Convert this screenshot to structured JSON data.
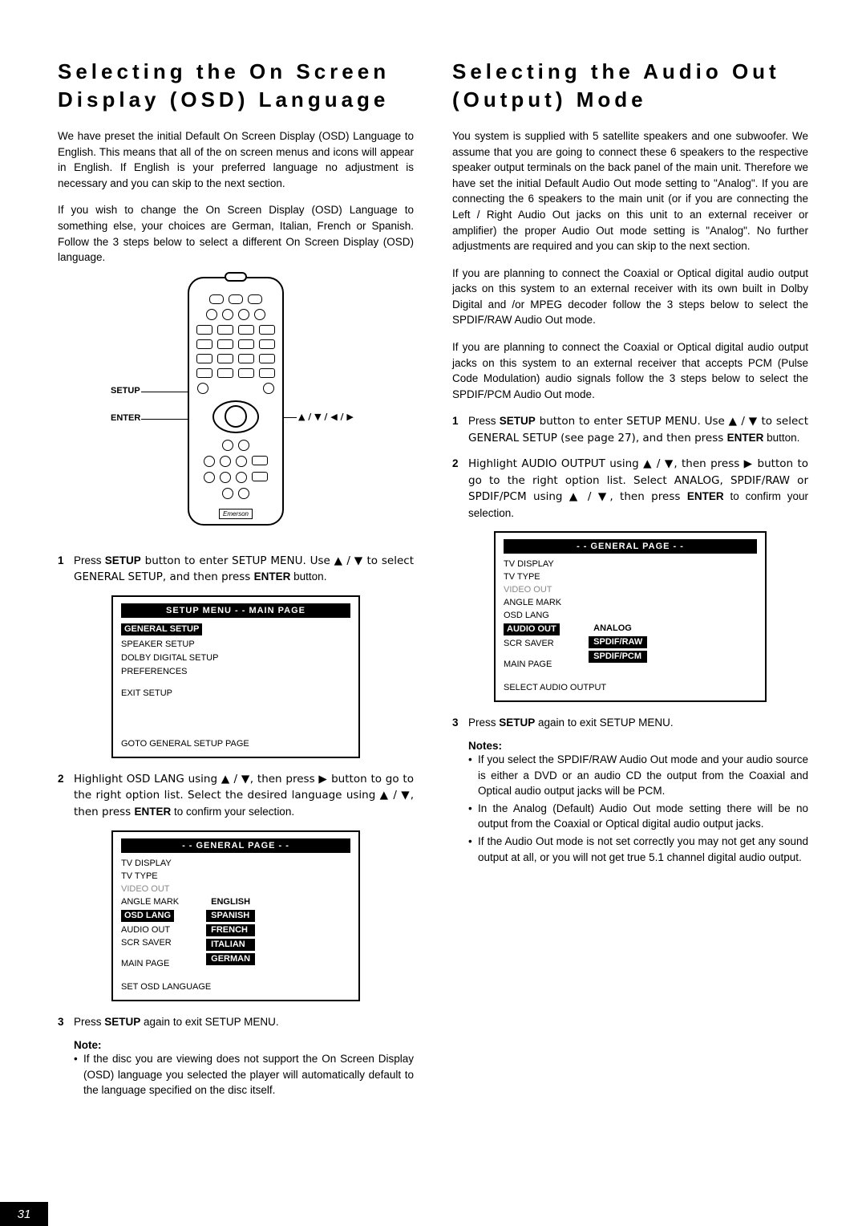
{
  "page_number": "31",
  "left": {
    "heading": "Selecting the On Screen Display (OSD) Language",
    "p1": "We have preset the initial Default On Screen Display (OSD) Language to English. This means that all of the on screen menus and icons will appear in English. If English is your preferred language no adjustment is necessary and you can skip to the next section.",
    "p2": "If you wish to change the On Screen Display (OSD) Language to something else, your choices are German, Italian, French or Spanish. Follow the 3 steps below to select a different On Screen Display (OSD) language.",
    "remote": {
      "label_setup": "SETUP",
      "label_enter": "ENTER",
      "label_arrows": "▲ / ▼ / ◀ / ▶",
      "brand": "Emerson"
    },
    "step1_a": "Press ",
    "step1_setup": "SETUP",
    "step1_b": " button to enter SETUP MENU. Use ▲ / ▼ to select GENERAL SETUP, and then press ",
    "step1_enter": "ENTER",
    "step1_c": " button.",
    "osd1": {
      "title": "SETUP MENU - - MAIN PAGE",
      "item_general": "GENERAL SETUP",
      "item_speaker": "SPEAKER SETUP",
      "item_dolby": "DOLBY DIGITAL SETUP",
      "item_pref": "PREFERENCES",
      "item_exit": "EXIT SETUP",
      "footer": "GOTO GENERAL SETUP PAGE"
    },
    "step2_a": "Highlight OSD LANG using ▲ / ▼, then press ▶ button to go to the right option list. Select the desired language using ▲ / ▼, then press ",
    "step2_enter": "ENTER",
    "step2_b": " to confirm your selection.",
    "osd2": {
      "title": "- - GENERAL PAGE - -",
      "left_items": {
        "tv_display": "TV DISPLAY",
        "tv_type": "TV TYPE",
        "video_out": "VIDEO OUT",
        "angle_mark": "ANGLE MARK",
        "osd_lang": "OSD LANG",
        "audio_out": "AUDIO OUT",
        "scr_saver": "SCR SAVER",
        "main_page": "MAIN PAGE"
      },
      "right_items": {
        "english": "ENGLISH",
        "spanish": "SPANISH",
        "french": "FRENCH",
        "italian": "ITALIAN",
        "german": "GERMAN"
      },
      "footer": "SET OSD LANGUAGE"
    },
    "step3_a": "Press ",
    "step3_setup": "SETUP",
    "step3_b": " again to exit SETUP MENU.",
    "note_label": "Note:",
    "note1": "If the disc you are viewing does not support the On Screen Display (OSD) language you selected the player will automatically default to the language specified on the disc itself."
  },
  "right": {
    "heading": "Selecting the Audio Out (Output) Mode",
    "p1": "You system is supplied with 5 satellite speakers and one subwoofer. We assume that you are going to connect these 6 speakers to the respective speaker output terminals on the back panel of the main unit. Therefore we have set the initial Default  Audio Out mode setting to \"Analog\". If you are connecting the 6 speakers to the main unit (or if you are connecting the Left / Right Audio Out jacks on this unit to an external receiver or amplifier) the proper Audio Out  mode setting is \"Analog\". No further adjustments are required and you can skip to the next section.",
    "p2": "If you are planning to connect the Coaxial or Optical digital audio output jacks on this system to an external receiver with its own built in Dolby Digital and /or MPEG decoder follow the 3 steps below to select the SPDIF/RAW Audio Out mode.",
    "p3": "If you are planning to connect the Coaxial or Optical digital audio output jacks on this system to an external receiver that accepts PCM (Pulse Code Modulation) audio signals follow the 3 steps below to select the SPDIF/PCM Audio Out mode.",
    "step1_a": "Press ",
    "step1_setup": "SETUP",
    "step1_b": " button to enter SETUP MENU. Use ▲ / ▼ to select GENERAL SETUP (see page 27), and then press ",
    "step1_enter": "ENTER",
    "step1_c": " button.",
    "step2_a": "Highlight AUDIO OUTPUT using ▲ / ▼, then press ▶ button to go to the right option list. Select ANALOG, SPDIF/RAW or SPDIF/PCM  using ▲ / ▼, then press ",
    "step2_enter": "ENTER",
    "step2_b": " to confirm your selection.",
    "osd": {
      "title": "- - GENERAL PAGE - -",
      "left_items": {
        "tv_display": "TV DISPLAY",
        "tv_type": "TV TYPE",
        "video_out": "VIDEO OUT",
        "angle_mark": "ANGLE MARK",
        "osd_lang": "OSD LANG",
        "audio_out": "AUDIO OUT",
        "scr_saver": "SCR SAVER",
        "main_page": "MAIN PAGE"
      },
      "right_items": {
        "analog": "ANALOG",
        "spdif_raw": "SPDIF/RAW",
        "spdif_pcm": "SPDIF/PCM"
      },
      "footer": "SELECT AUDIO OUTPUT"
    },
    "step3_a": "Press ",
    "step3_setup": "SETUP",
    "step3_b": " again to exit SETUP MENU.",
    "notes_label": "Notes:",
    "note1": "If you select the SPDIF/RAW Audio Out mode and your audio source is either a DVD or an audio CD the output from the Coaxial and Optical audio output jacks will be PCM.",
    "note2": "In the Analog (Default) Audio Out mode setting there will be no output from the Coaxial or Optical digital audio output jacks.",
    "note3": "If the Audio Out mode is not set correctly you may not get any sound output at all, or you will not get true 5.1 channel digital audio output."
  }
}
